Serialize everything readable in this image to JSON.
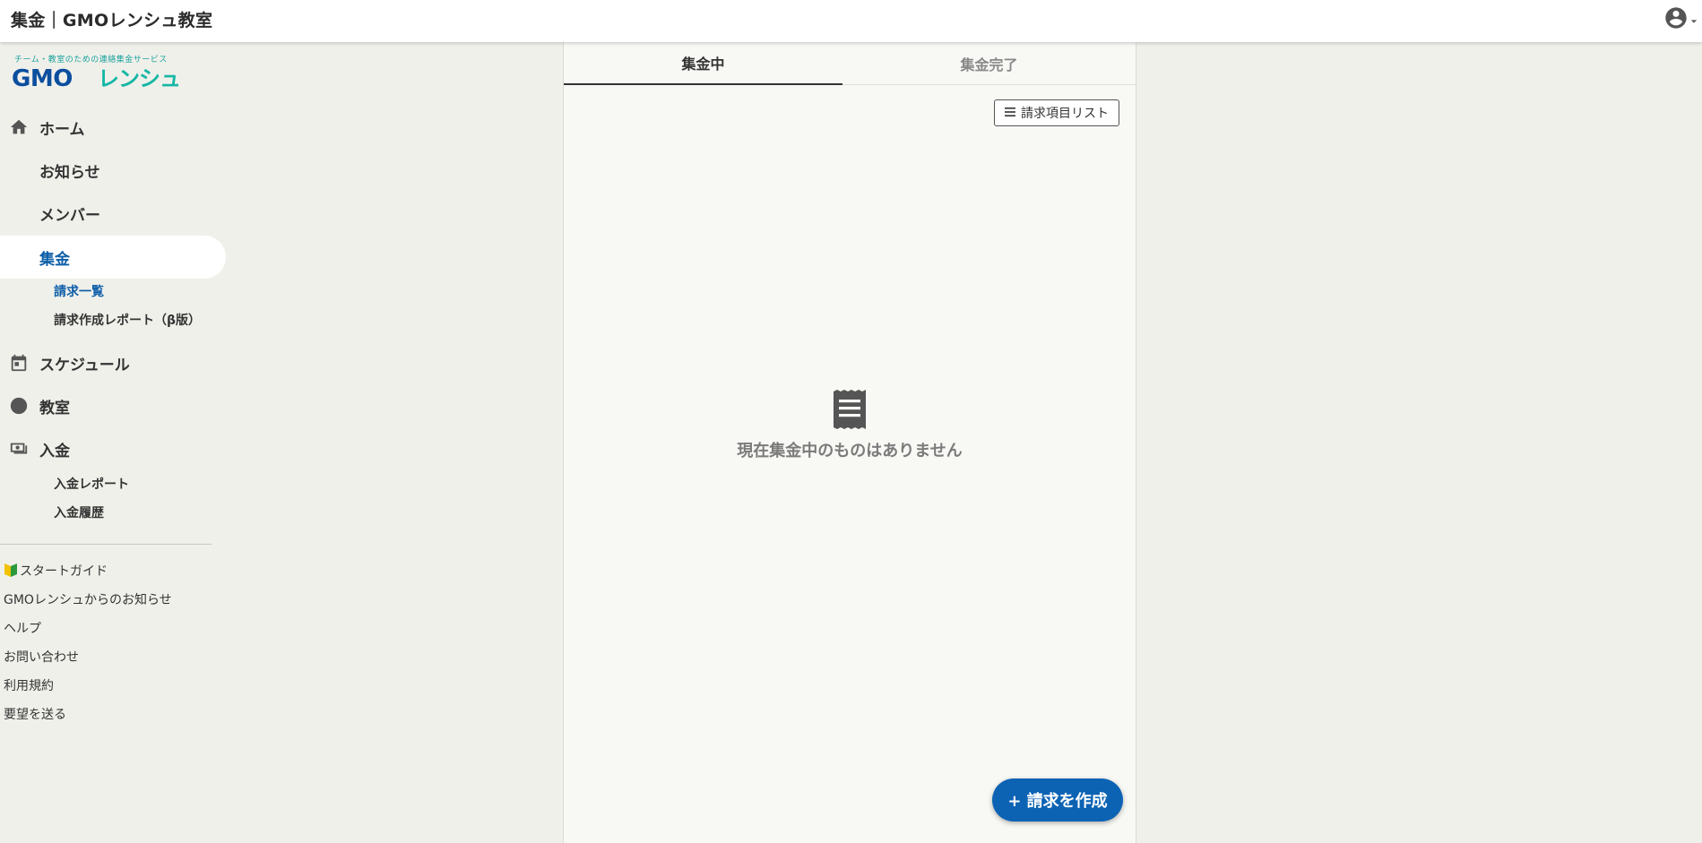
{
  "header": {
    "title": "集金｜GMOレンシュ教室",
    "user_icon": "account-circle-icon"
  },
  "brand": {
    "tagline": "チーム・教室のための連絡集金サービス",
    "name_gmo": "GMO",
    "name_rensh": "レンシュ"
  },
  "sidebar": {
    "items": [
      {
        "label": "ホーム",
        "icon": "home-icon"
      },
      {
        "label": "お知らせ",
        "icon": ""
      },
      {
        "label": "メンバー",
        "icon": ""
      },
      {
        "label": "集金",
        "icon": "",
        "active": true
      },
      {
        "label": "スケジュール",
        "icon": "calendar-icon"
      },
      {
        "label": "教室",
        "icon": "circle-icon"
      },
      {
        "label": "入金",
        "icon": "money-icon"
      }
    ],
    "sub_collection": [
      {
        "label": "請求一覧",
        "active": true
      },
      {
        "label": "請求作成レポート（β版）"
      }
    ],
    "sub_deposit": [
      {
        "label": "入金レポート"
      },
      {
        "label": "入金履歴"
      }
    ],
    "footer_links": [
      {
        "label": "スタートガイド",
        "icon": "beginner-mark-icon"
      },
      {
        "label": "GMOレンシュからのお知らせ"
      },
      {
        "label": "ヘルプ"
      },
      {
        "label": "お問い合わせ"
      },
      {
        "label": "利用規約"
      },
      {
        "label": "要望を送る"
      }
    ]
  },
  "main": {
    "tabs": [
      {
        "label": "集金中",
        "active": true
      },
      {
        "label": "集金完了"
      }
    ],
    "list_button_label": "請求項目リスト",
    "empty_message": "現在集金中のものはありません",
    "empty_icon": "receipt-icon",
    "create_button_label": "+ 請求を作成"
  },
  "colors": {
    "accent": "#0c63b4",
    "active_text": "#0c5ea8",
    "brand_teal": "#16b7a5",
    "brand_blue": "#0b4e9e",
    "sidebar_bg": "#f0f0eb"
  }
}
